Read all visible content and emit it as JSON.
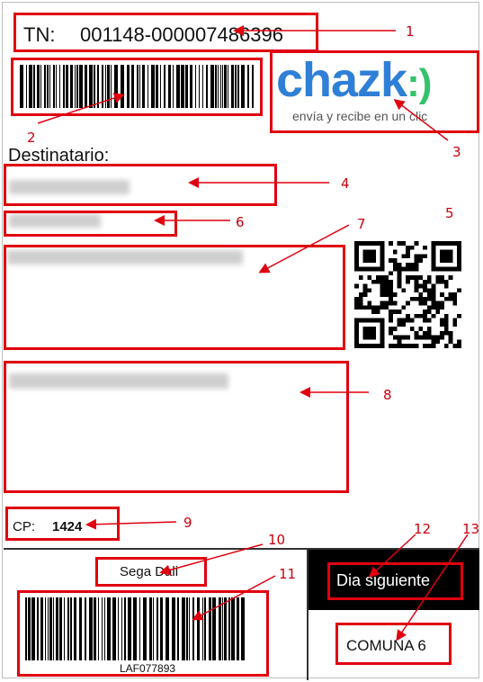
{
  "label": {
    "tracking_prefix": "TN:",
    "tracking_number": "001148-000007486396",
    "recipient_heading": "Destinatario:",
    "postal_prefix": "CP:",
    "postal_code": "1424",
    "store_name": "Sega Dali",
    "bottom_barcode_text": "LAF077893",
    "service_type": "Dia siguiente",
    "commune": "COMUNA 6"
  },
  "logo": {
    "wordmark_left": "chazk",
    "wordmark_right": ":)",
    "tagline": "envía y recibe en un clic",
    "color": "#2f7fd6",
    "accent": "#34c26a"
  },
  "annotations": [
    "1",
    "2",
    "3",
    "4",
    "5",
    "6",
    "7",
    "8",
    "9",
    "10",
    "11",
    "12",
    "13"
  ],
  "colors": {
    "annotation_red": "#e0000f",
    "ink": "#000000"
  }
}
